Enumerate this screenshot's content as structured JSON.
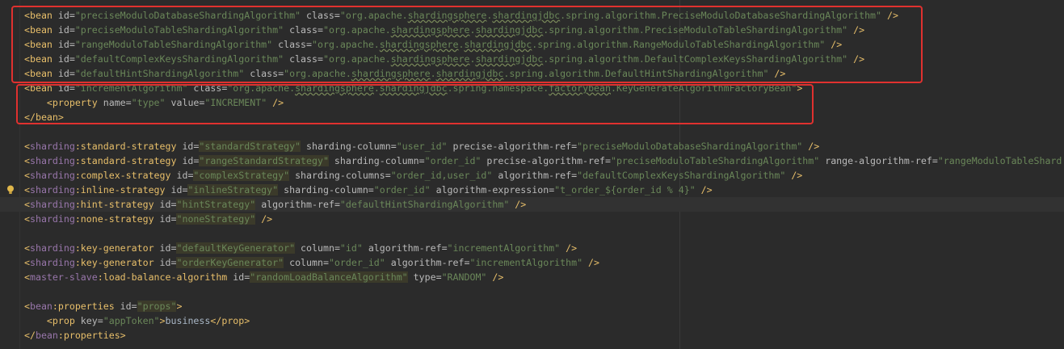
{
  "lines": [
    {
      "row": 0,
      "indent": 0,
      "tokens": [
        {
          "t": "<",
          "c": "tag"
        },
        {
          "t": "bean",
          "c": "tag"
        },
        {
          "t": " id=",
          "c": "attr"
        },
        {
          "t": "\"preciseModuloDatabaseShardingAlgorithm\"",
          "c": "str"
        },
        {
          "t": " class=",
          "c": "attr"
        },
        {
          "t": "\"org.apache.",
          "c": "str"
        },
        {
          "t": "shardingsphere",
          "c": "str",
          "w": 1
        },
        {
          "t": ".",
          "c": "str"
        },
        {
          "t": "shardingjdbc",
          "c": "str",
          "w": 1
        },
        {
          "t": ".spring.algorithm.PreciseModuloDatabaseShardingAlgorithm\"",
          "c": "str"
        },
        {
          "t": " />",
          "c": "tag"
        }
      ]
    },
    {
      "row": 1,
      "indent": 0,
      "tokens": [
        {
          "t": "<",
          "c": "tag"
        },
        {
          "t": "bean",
          "c": "tag"
        },
        {
          "t": " id=",
          "c": "attr"
        },
        {
          "t": "\"preciseModuloTableShardingAlgorithm\"",
          "c": "str"
        },
        {
          "t": " class=",
          "c": "attr"
        },
        {
          "t": "\"org.apache.",
          "c": "str"
        },
        {
          "t": "shardingsphere",
          "c": "str",
          "w": 1
        },
        {
          "t": ".",
          "c": "str"
        },
        {
          "t": "shardingjdbc",
          "c": "str",
          "w": 1
        },
        {
          "t": ".spring.algorithm.PreciseModuloTableShardingAlgorithm\"",
          "c": "str"
        },
        {
          "t": " />",
          "c": "tag"
        }
      ]
    },
    {
      "row": 2,
      "indent": 0,
      "tokens": [
        {
          "t": "<",
          "c": "tag"
        },
        {
          "t": "bean",
          "c": "tag"
        },
        {
          "t": " id=",
          "c": "attr"
        },
        {
          "t": "\"rangeModuloTableShardingAlgorithm\"",
          "c": "str"
        },
        {
          "t": " class=",
          "c": "attr"
        },
        {
          "t": "\"org.apache.",
          "c": "str"
        },
        {
          "t": "shardingsphere",
          "c": "str",
          "w": 1
        },
        {
          "t": ".",
          "c": "str"
        },
        {
          "t": "shardingjdbc",
          "c": "str",
          "w": 1
        },
        {
          "t": ".spring.algorithm.RangeModuloTableShardingAlgorithm\"",
          "c": "str"
        },
        {
          "t": " />",
          "c": "tag"
        }
      ]
    },
    {
      "row": 3,
      "indent": 0,
      "tokens": [
        {
          "t": "<",
          "c": "tag"
        },
        {
          "t": "bean",
          "c": "tag"
        },
        {
          "t": " id=",
          "c": "attr"
        },
        {
          "t": "\"defaultComplexKeysShardingAlgorithm\"",
          "c": "str"
        },
        {
          "t": " class=",
          "c": "attr"
        },
        {
          "t": "\"org.apache.",
          "c": "str"
        },
        {
          "t": "shardingsphere",
          "c": "str",
          "w": 1
        },
        {
          "t": ".",
          "c": "str"
        },
        {
          "t": "shardingjdbc",
          "c": "str",
          "w": 1
        },
        {
          "t": ".spring.algorithm.DefaultComplexKeysShardingAlgorithm\"",
          "c": "str"
        },
        {
          "t": " />",
          "c": "tag"
        }
      ]
    },
    {
      "row": 4,
      "indent": 0,
      "tokens": [
        {
          "t": "<",
          "c": "tag"
        },
        {
          "t": "bean",
          "c": "tag"
        },
        {
          "t": " id=",
          "c": "attr"
        },
        {
          "t": "\"defaultHintShardingAlgorithm\"",
          "c": "str"
        },
        {
          "t": " class=",
          "c": "attr"
        },
        {
          "t": "\"org.apache.",
          "c": "str"
        },
        {
          "t": "shardingsphere",
          "c": "str",
          "w": 1
        },
        {
          "t": ".",
          "c": "str"
        },
        {
          "t": "shardingjdbc",
          "c": "str",
          "w": 1
        },
        {
          "t": ".spring.algorithm.DefaultHintShardingAlgorithm\"",
          "c": "str"
        },
        {
          "t": " />",
          "c": "tag"
        }
      ]
    },
    {
      "row": 5,
      "indent": 0,
      "tokens": [
        {
          "t": "<",
          "c": "tag"
        },
        {
          "t": "bean",
          "c": "tag"
        },
        {
          "t": " id=",
          "c": "attr"
        },
        {
          "t": "\"incrementAlgorithm\"",
          "c": "str"
        },
        {
          "t": " class=",
          "c": "attr"
        },
        {
          "t": "\"org.apache.",
          "c": "str"
        },
        {
          "t": "shardingsphere",
          "c": "str",
          "w": 1
        },
        {
          "t": ".",
          "c": "str"
        },
        {
          "t": "shardingjdbc",
          "c": "str",
          "w": 1
        },
        {
          "t": ".spring.namespace.",
          "c": "str"
        },
        {
          "t": "factorybean",
          "c": "str",
          "w": 1
        },
        {
          "t": ".KeyGenerateAlgorithmFactoryBean\"",
          "c": "str"
        },
        {
          "t": ">",
          "c": "tag"
        }
      ]
    },
    {
      "row": 6,
      "indent": 4,
      "tokens": [
        {
          "t": "<",
          "c": "tag"
        },
        {
          "t": "property",
          "c": "tag"
        },
        {
          "t": " name=",
          "c": "attr"
        },
        {
          "t": "\"type\"",
          "c": "str"
        },
        {
          "t": " value=",
          "c": "attr"
        },
        {
          "t": "\"INCREMENT\"",
          "c": "str"
        },
        {
          "t": " />",
          "c": "tag"
        }
      ]
    },
    {
      "row": 7,
      "indent": 0,
      "tokens": [
        {
          "t": "</",
          "c": "tag"
        },
        {
          "t": "bean",
          "c": "tag"
        },
        {
          "t": ">",
          "c": "tag"
        }
      ]
    },
    {
      "row": 9,
      "indent": 0,
      "tokens": [
        {
          "t": "<",
          "c": "tag"
        },
        {
          "t": "sharding",
          "c": "ns"
        },
        {
          "t": ":standard-strategy",
          "c": "tag"
        },
        {
          "t": " id=",
          "c": "attr"
        },
        {
          "t": "\"standardStrategy\"",
          "c": "idval"
        },
        {
          "t": " sharding-column=",
          "c": "attr"
        },
        {
          "t": "\"user_id\"",
          "c": "str"
        },
        {
          "t": " precise-algorithm-ref=",
          "c": "attr"
        },
        {
          "t": "\"preciseModuloDatabaseShardingAlgorithm\"",
          "c": "str"
        },
        {
          "t": " />",
          "c": "tag"
        }
      ]
    },
    {
      "row": 10,
      "indent": 0,
      "tokens": [
        {
          "t": "<",
          "c": "tag"
        },
        {
          "t": "sharding",
          "c": "ns"
        },
        {
          "t": ":standard-strategy",
          "c": "tag"
        },
        {
          "t": " id=",
          "c": "attr"
        },
        {
          "t": "\"rangeStandardStrategy\"",
          "c": "idval"
        },
        {
          "t": " sharding-column=",
          "c": "attr"
        },
        {
          "t": "\"order_id\"",
          "c": "str"
        },
        {
          "t": " precise-algorithm-ref=",
          "c": "attr"
        },
        {
          "t": "\"preciseModuloTableShardingAlgorithm\"",
          "c": "str"
        },
        {
          "t": " range-algorithm-ref=",
          "c": "attr"
        },
        {
          "t": "\"rangeModuloTableShard",
          "c": "str"
        }
      ]
    },
    {
      "row": 11,
      "indent": 0,
      "tokens": [
        {
          "t": "<",
          "c": "tag"
        },
        {
          "t": "sharding",
          "c": "ns"
        },
        {
          "t": ":complex-strategy",
          "c": "tag"
        },
        {
          "t": " id=",
          "c": "attr"
        },
        {
          "t": "\"complexStrategy\"",
          "c": "idval"
        },
        {
          "t": " sharding-columns=",
          "c": "attr"
        },
        {
          "t": "\"order_id,user_id\"",
          "c": "str"
        },
        {
          "t": " algorithm-ref=",
          "c": "attr"
        },
        {
          "t": "\"defaultComplexKeysShardingAlgorithm\"",
          "c": "str"
        },
        {
          "t": " />",
          "c": "tag"
        }
      ]
    },
    {
      "row": 12,
      "indent": 0,
      "tokens": [
        {
          "t": "<",
          "c": "tag"
        },
        {
          "t": "sharding",
          "c": "ns"
        },
        {
          "t": ":inline-strategy",
          "c": "tag"
        },
        {
          "t": " id=",
          "c": "attr"
        },
        {
          "t": "\"inlineStrategy\"",
          "c": "idval"
        },
        {
          "t": " sharding-column=",
          "c": "attr"
        },
        {
          "t": "\"order_id\"",
          "c": "str"
        },
        {
          "t": " algorithm-expression=",
          "c": "attr"
        },
        {
          "t": "\"t_order_${order_id % 4}\"",
          "c": "str"
        },
        {
          "t": " />",
          "c": "tag"
        }
      ]
    },
    {
      "row": 13,
      "indent": 0,
      "tokens": [
        {
          "t": "<",
          "c": "tag"
        },
        {
          "t": "sharding",
          "c": "ns"
        },
        {
          "t": ":hint-strategy",
          "c": "tag"
        },
        {
          "t": " id=",
          "c": "attr"
        },
        {
          "t": "\"hintStrategy\"",
          "c": "idval"
        },
        {
          "t": " algorithm-ref=",
          "c": "attr"
        },
        {
          "t": "\"defaultHintShardingAlgorithm\"",
          "c": "str"
        },
        {
          "t": " />",
          "c": "tag"
        }
      ]
    },
    {
      "row": 14,
      "indent": 0,
      "tokens": [
        {
          "t": "<",
          "c": "tag"
        },
        {
          "t": "sharding",
          "c": "ns"
        },
        {
          "t": ":none-strategy",
          "c": "tag"
        },
        {
          "t": " id=",
          "c": "attr"
        },
        {
          "t": "\"noneStrategy\"",
          "c": "idval"
        },
        {
          "t": " />",
          "c": "tag"
        }
      ]
    },
    {
      "row": 16,
      "indent": 0,
      "tokens": [
        {
          "t": "<",
          "c": "tag"
        },
        {
          "t": "sharding",
          "c": "ns"
        },
        {
          "t": ":key-generator",
          "c": "tag"
        },
        {
          "t": " id=",
          "c": "attr"
        },
        {
          "t": "\"defaultKeyGenerator\"",
          "c": "idval"
        },
        {
          "t": " column=",
          "c": "attr"
        },
        {
          "t": "\"id\"",
          "c": "str"
        },
        {
          "t": " algorithm-ref=",
          "c": "attr"
        },
        {
          "t": "\"incrementAlgorithm\"",
          "c": "str"
        },
        {
          "t": " />",
          "c": "tag"
        }
      ]
    },
    {
      "row": 17,
      "indent": 0,
      "tokens": [
        {
          "t": "<",
          "c": "tag"
        },
        {
          "t": "sharding",
          "c": "ns"
        },
        {
          "t": ":key-generator",
          "c": "tag"
        },
        {
          "t": " id=",
          "c": "attr"
        },
        {
          "t": "\"orderKeyGenerator\"",
          "c": "idval"
        },
        {
          "t": " column=",
          "c": "attr"
        },
        {
          "t": "\"order_id\"",
          "c": "str"
        },
        {
          "t": " algorithm-ref=",
          "c": "attr"
        },
        {
          "t": "\"incrementAlgorithm\"",
          "c": "str"
        },
        {
          "t": " />",
          "c": "tag"
        }
      ]
    },
    {
      "row": 18,
      "indent": 0,
      "tokens": [
        {
          "t": "<",
          "c": "tag"
        },
        {
          "t": "master-slave",
          "c": "ns"
        },
        {
          "t": ":load-balance-algorithm",
          "c": "tag"
        },
        {
          "t": " id=",
          "c": "attr"
        },
        {
          "t": "\"randomLoadBalanceAlgorithm\"",
          "c": "idval"
        },
        {
          "t": " type=",
          "c": "attr"
        },
        {
          "t": "\"RANDOM\"",
          "c": "str"
        },
        {
          "t": " />",
          "c": "tag"
        }
      ]
    },
    {
      "row": 20,
      "indent": 0,
      "tokens": [
        {
          "t": "<",
          "c": "tag"
        },
        {
          "t": "bean",
          "c": "ns"
        },
        {
          "t": ":properties",
          "c": "tag"
        },
        {
          "t": " id=",
          "c": "attr"
        },
        {
          "t": "\"props\"",
          "c": "idval"
        },
        {
          "t": ">",
          "c": "tag"
        }
      ]
    },
    {
      "row": 21,
      "indent": 4,
      "tokens": [
        {
          "t": "<",
          "c": "tag"
        },
        {
          "t": "prop",
          "c": "tag"
        },
        {
          "t": " key=",
          "c": "attr"
        },
        {
          "t": "\"appToken\"",
          "c": "str"
        },
        {
          "t": ">",
          "c": "tag"
        },
        {
          "t": "business",
          "c": "txt"
        },
        {
          "t": "</",
          "c": "tag"
        },
        {
          "t": "prop",
          "c": "tag"
        },
        {
          "t": ">",
          "c": "tag"
        }
      ]
    },
    {
      "row": 22,
      "indent": 0,
      "tokens": [
        {
          "t": "</",
          "c": "tag"
        },
        {
          "t": "bean",
          "c": "ns"
        },
        {
          "t": ":properties",
          "c": "tag"
        },
        {
          "t": ">",
          "c": "tag"
        }
      ]
    }
  ],
  "current_line_row": 13,
  "bulb_row": 12,
  "icons": {
    "bulb": "lightbulb-icon"
  },
  "colors": {
    "highlight_box": "#e0312f",
    "background": "#2b2b2b"
  }
}
